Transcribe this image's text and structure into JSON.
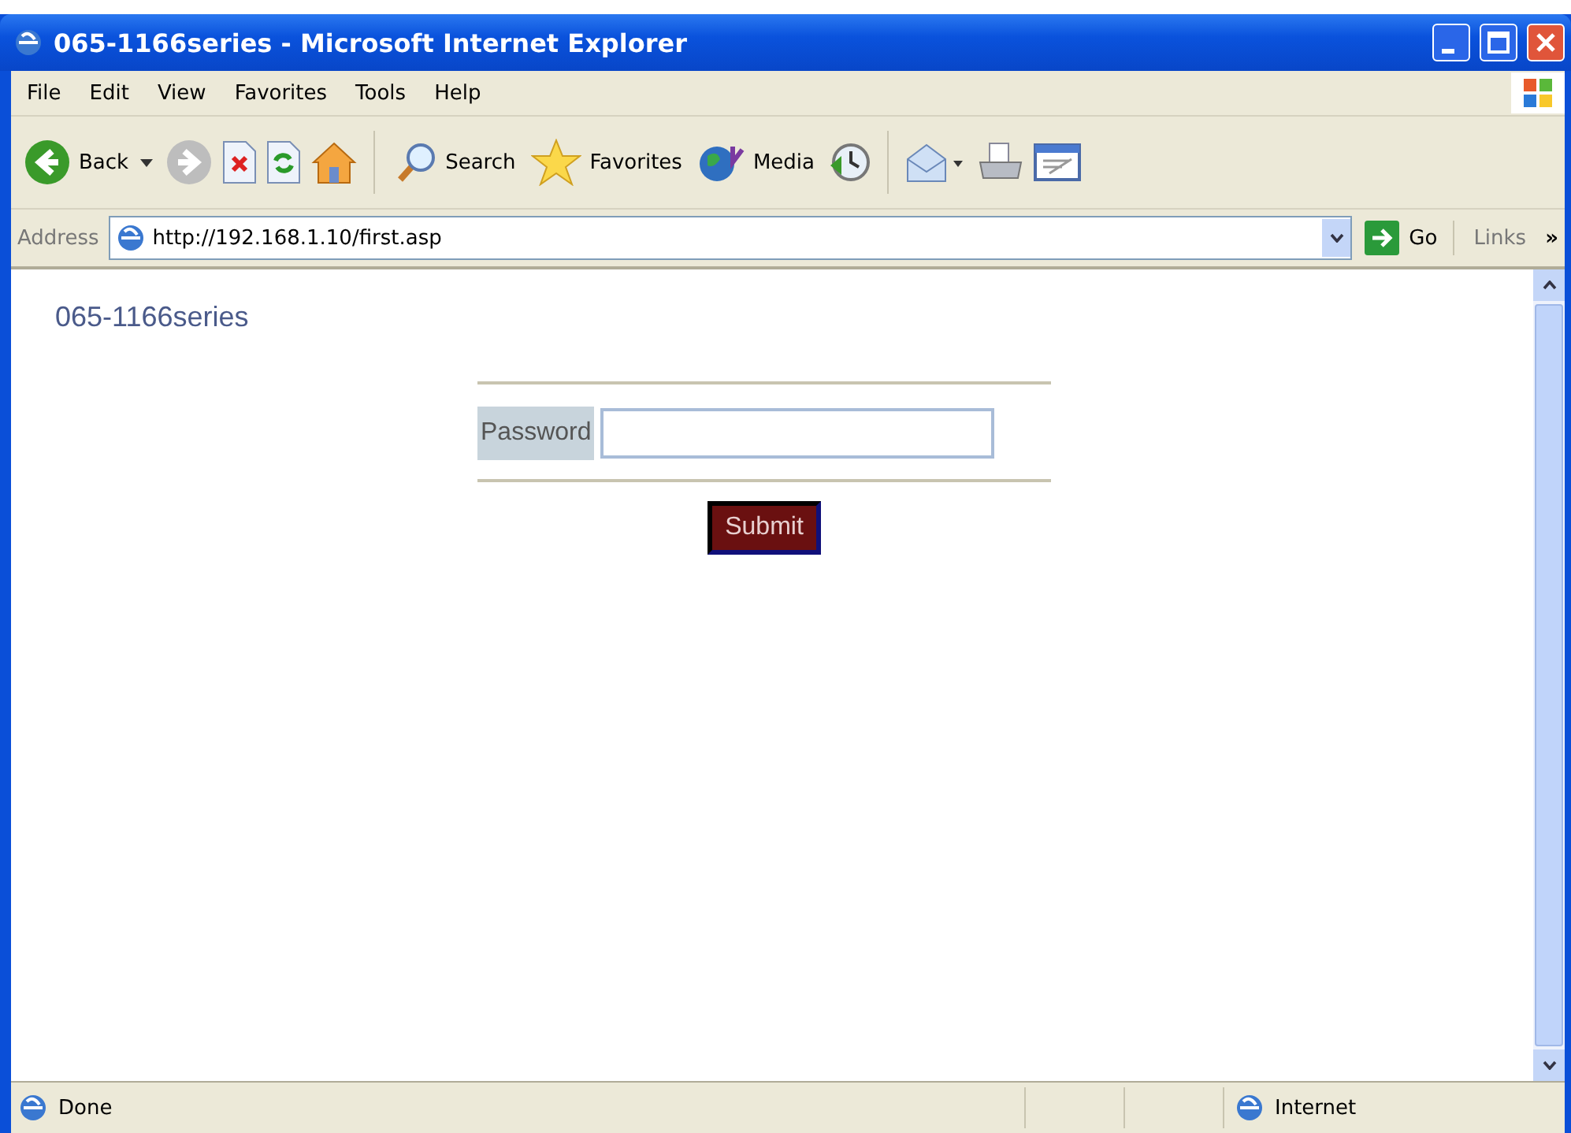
{
  "window": {
    "title": "065-1166series - Microsoft Internet Explorer"
  },
  "menu": [
    "File",
    "Edit",
    "View",
    "Favorites",
    "Tools",
    "Help"
  ],
  "toolbar": [
    {
      "kind": "back",
      "label": "Back"
    },
    {
      "kind": "forward"
    },
    {
      "kind": "stop"
    },
    {
      "kind": "refresh"
    },
    {
      "kind": "home"
    },
    {
      "kind": "sep"
    },
    {
      "kind": "search",
      "label": "Search"
    },
    {
      "kind": "favorites",
      "label": "Favorites"
    },
    {
      "kind": "media",
      "label": "Media"
    },
    {
      "kind": "history"
    },
    {
      "kind": "sep"
    },
    {
      "kind": "mail"
    },
    {
      "kind": "print"
    },
    {
      "kind": "edit"
    }
  ],
  "address_bar": {
    "label": "Address",
    "url": "http://192.168.1.10/first.asp",
    "go": "Go",
    "links": "Links",
    "more": "»"
  },
  "page": {
    "heading": "065-1166series",
    "password_label": "Password",
    "submit": "Submit"
  },
  "status_bar": {
    "text": "Done",
    "zone": "Internet"
  }
}
